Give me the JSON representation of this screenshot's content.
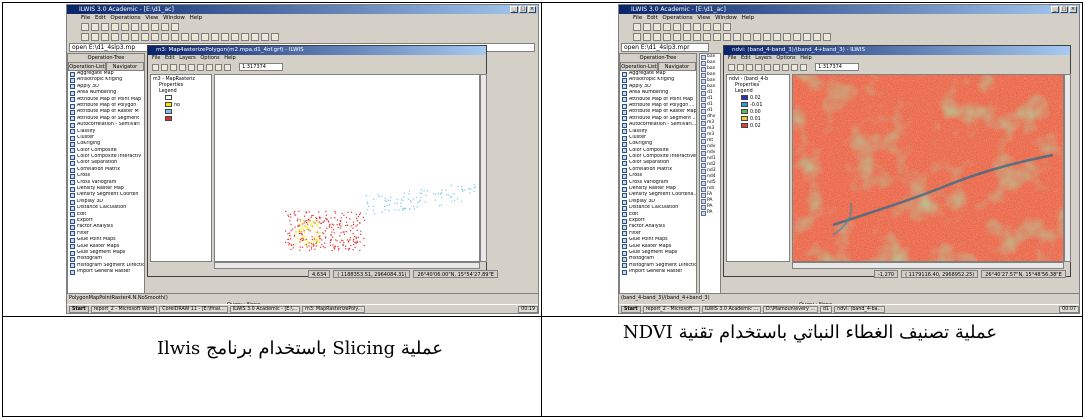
{
  "captions": {
    "left": "عملية Slicing باستخدام برنامج Ilwis",
    "right": "عملية تصنيف الغطاء النباتي باستخدام تقنية NDVI"
  },
  "left_screenshot": {
    "app_title": "ILWIS 3.0 Academic - [E:\\d1_ac]",
    "menu": "File  Edit  Operations  View  Window  Help",
    "command_line": "open E:\\d1_4slp3.mp",
    "optree": {
      "title": "Operation-Tree",
      "tabs": [
        "Operation-List",
        "Navigator"
      ]
    },
    "operations": [
      "Aggregate Map",
      "Anisotropic Kriging",
      "Apply 3D",
      "Area Numbering",
      "Attribute Map of Point Map",
      "Attribute Map of Polygon",
      "Attribute Map of Raster M",
      "Attribute Map of Segment",
      "Autocorrelation - Semivari",
      "Classify",
      "Cluster",
      "CoKriging",
      "Color Composite",
      "Color Composite Interactiv",
      "Color Separation",
      "Correlation Matrix",
      "Cross",
      "Cross Variogram",
      "Density Raster Map",
      "Density Segment Coordin",
      "Display 3D",
      "Distance Calculation",
      "Edit",
      "Export",
      "Factor Analysis",
      "Filter",
      "Glue Point Maps",
      "Glue Raster Maps",
      "Glue Segment Maps",
      "Histogram",
      "Histogram Segment Direction",
      "Import General Raster"
    ],
    "map_window": {
      "title": "m3: Map4asterizePolygon(m2.mpa,d1_4of.grf) - ILWIS",
      "menu": "File  Edit  Layers  Options  Help",
      "scale": "1:317374",
      "legend_title": "m3 - MapRasteriz",
      "legend_items": [
        "Properties",
        "Legend"
      ],
      "legend_labels": [
        "",
        "no",
        "",
        ""
      ],
      "legend_colors": [
        "#ffffff",
        "#f4e800",
        "#7fc7e8",
        "#e03030"
      ],
      "status": [
        "4,634",
        "( 1188353.51, 2964084.31)",
        "26°40'06.00\"N, 15°54'27.89\"E"
      ]
    },
    "query_status": "Query : None",
    "status_path": "PolygonMapPointRaster4.N.NoSmooth()",
    "taskbar": [
      "Start",
      "report_2 - Microsoft Word",
      "CorelDRAW 11 - [E:\\final...",
      "ILWIS 3.0 Academic - [E:\\...",
      "m3: MapRasterizePoly..."
    ],
    "clock": "00:19"
  },
  "right_screenshot": {
    "app_title": "ILWIS 3.0 Academic - [E:\\d1_ac]",
    "menu": "File  Edit  Operations  View  Window  Help",
    "command_line": "open E:\\d1_4slp3.mpr",
    "optree": {
      "title": "Operation-Tree",
      "tabs": [
        "Operation-List",
        "Navigator"
      ]
    },
    "operations": [
      "Aggregate Map",
      "Anisotropic Kriging",
      "Apply 3D",
      "Area Numbering",
      "Attribute Map of Point Map",
      "Attribute Map of Polygon ...",
      "Attribute Map of Raster Map",
      "Attribute Map of Segment ...",
      "Autocorrelation - Semivari...",
      "Classify",
      "Cluster",
      "CoKriging",
      "Color Composite",
      "Color Composite Interactive",
      "Color Separation",
      "Correlation Matrix",
      "Cross",
      "Cross Variogram",
      "Density Raster Map",
      "Density Segment Coordina...",
      "Display 3D",
      "Distance Calculation",
      "Edit",
      "Export",
      "Factor Analysis",
      "Filter",
      "Glue Point Maps",
      "Glue Raster Maps",
      "Glue Segment Maps",
      "Histogram",
      "Histogram Segment Direction",
      "Import General Raster"
    ],
    "catalog": [
      "ban",
      "ban",
      "ban",
      "ban",
      "ban",
      "ban",
      "d1",
      "d1",
      "d1",
      "d1",
      "dhv",
      "m3",
      "m3",
      "m3",
      "mt",
      "ndv",
      "ndv",
      "nd1",
      "nd2",
      "nd3",
      "nd4",
      "nd5",
      "ndr",
      "FA",
      "PA",
      "PA",
      "PA"
    ],
    "map_window": {
      "title": "ndvi: (band_4-band_3)/(band_4+band_3) - ILWIS",
      "menu": "File  Edit  Layers  Options  Help",
      "scale": "1:317374",
      "legend_title": "ndvi - (band_4-b",
      "legend_items": [
        "Properties",
        "Legend"
      ],
      "legend_labels": [
        "0.02",
        "-0.01",
        "0.00",
        "0.01",
        "0.02"
      ],
      "legend_colors": [
        "#3030c0",
        "#30a0d0",
        "#50c050",
        "#e8d030",
        "#e04040"
      ],
      "status": [
        "-1,270",
        "( 1179116.40, 2968952.25)",
        "26°40'27.57\"N, 15°48'56.38\"E"
      ]
    },
    "query_status": "Query : None",
    "status_path": "(band_4-band_3)/(band_4+band_3)",
    "taskbar": [
      "Start",
      "report_2 - Microsoft...",
      "ILWIS 3.0 Academic ...",
      "D:\\Mamoun\\every ...",
      "d1",
      "ndvi: (band_4-ba..."
    ],
    "clock": "00:07"
  }
}
